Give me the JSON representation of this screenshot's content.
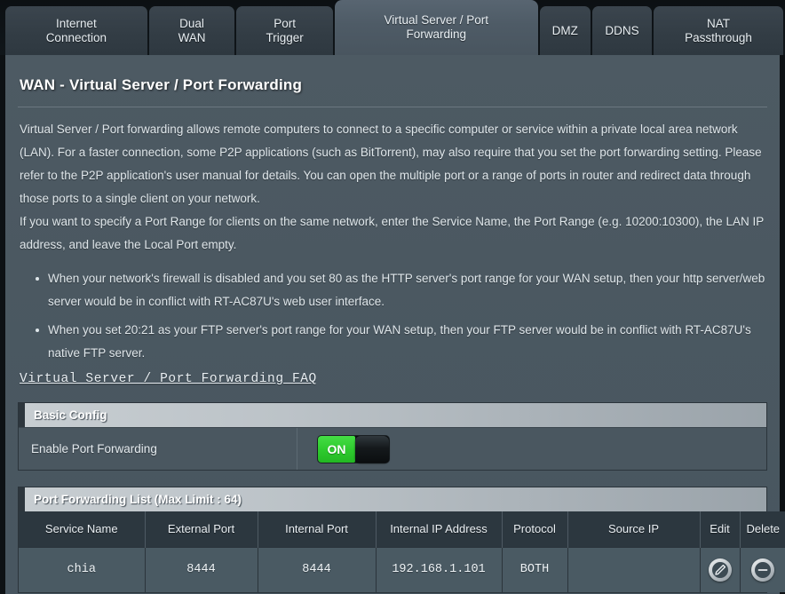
{
  "tabs": [
    {
      "label": "Internet\nConnection",
      "active": false
    },
    {
      "label": "Dual\nWAN",
      "active": false
    },
    {
      "label": "Port\nTrigger",
      "active": false
    },
    {
      "label": "Virtual Server / Port\nForwarding",
      "active": true
    },
    {
      "label": "DMZ",
      "active": false
    },
    {
      "label": "DDNS",
      "active": false
    },
    {
      "label": "NAT\nPassthrough",
      "active": false
    }
  ],
  "page": {
    "title": "WAN - Virtual Server / Port Forwarding",
    "paragraphs": [
      "Virtual Server / Port forwarding allows remote computers to connect to a specific computer or service within a private local area network (LAN). For a faster connection, some P2P applications (such as BitTorrent), may also require that you set the port forwarding setting. Please refer to the P2P application's user manual for details. You can open the multiple port or a range of ports in router and redirect data through those ports to a single client on your network.",
      "If you want to specify a Port Range for clients on the same network, enter the Service Name, the Port Range (e.g. 10200:10300), the LAN IP address, and leave the Local Port empty."
    ],
    "notes": [
      "When your network's firewall is disabled and you set 80 as the HTTP server's port range for your WAN setup, then your http server/web server would be in conflict with RT-AC87U's web user interface.",
      "When you set 20:21 as your FTP server's port range for your WAN setup, then your FTP server would be in conflict with RT-AC87U's native FTP server."
    ],
    "faq_link": "Virtual Server / Port Forwarding FAQ"
  },
  "basic_config": {
    "header": "Basic Config",
    "enable_label": "Enable Port Forwarding",
    "toggle_state": "ON",
    "toggle_color": "#2fcb2f"
  },
  "list_section": {
    "header": "Port Forwarding List (Max Limit : 64)",
    "columns": [
      "Service Name",
      "External Port",
      "Internal Port",
      "Internal IP Address",
      "Protocol",
      "Source IP",
      "Edit",
      "Delete"
    ],
    "rows": [
      {
        "service_name": "chia",
        "external_port": "8444",
        "internal_port": "8444",
        "internal_ip": "192.168.1.101",
        "protocol": "BOTH",
        "source_ip": "",
        "edit_icon": "pencil-icon",
        "delete_icon": "minus-circle-icon"
      }
    ]
  }
}
